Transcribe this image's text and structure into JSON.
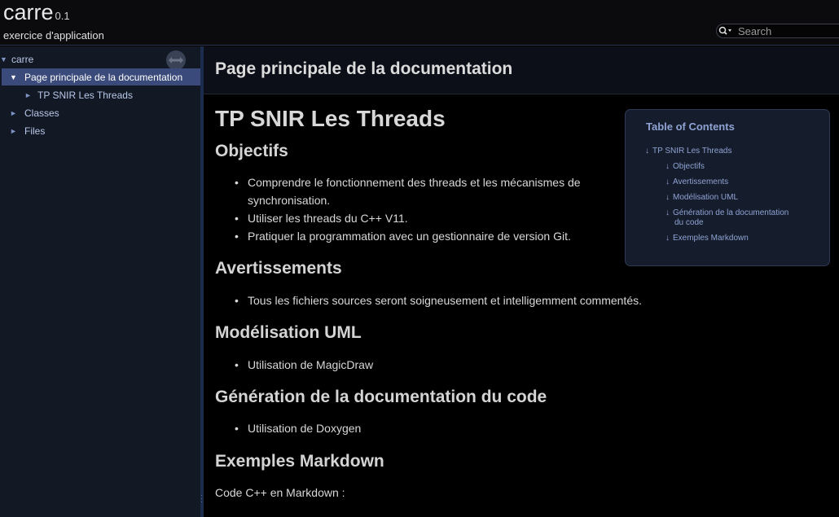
{
  "header": {
    "project_name": "carre",
    "project_number": "0.1",
    "project_brief": "exercice d'application",
    "search_placeholder": "Search"
  },
  "sidebar": {
    "items": [
      {
        "label": "carre",
        "arrow": "▼"
      },
      {
        "label": "Page principale de la documentation",
        "arrow": "▼",
        "selected": true
      },
      {
        "label": "TP SNIR Les Threads",
        "arrow": "►"
      },
      {
        "label": "Classes",
        "arrow": "►"
      },
      {
        "label": "Files",
        "arrow": "►"
      }
    ]
  },
  "main": {
    "page_title": "Page principale de la documentation",
    "h1": "TP SNIR Les Threads",
    "sections": [
      {
        "heading": "Objectifs",
        "items": [
          "Comprendre le fonctionnement des threads et les mécanismes de",
          "synchronisation.",
          "Utiliser les threads du C++ V11.",
          "Pratiquer la programmation avec un gestionnaire de version Git."
        ]
      },
      {
        "heading": "Avertissements",
        "items": [
          "Tous les fichiers sources seront soigneusement et intelligemment commentés."
        ]
      },
      {
        "heading": "Modélisation UML",
        "items": [
          "Utilisation de MagicDraw"
        ]
      },
      {
        "heading": "Génération de la documentation du code",
        "items": [
          "Utilisation de Doxygen"
        ]
      },
      {
        "heading": "Exemples Markdown",
        "paragraph": "Code C++ en Markdown :"
      }
    ]
  },
  "toc": {
    "title": "Table of Contents",
    "arrow": "↓",
    "entries": [
      "TP SNIR Les Threads",
      "Objectifs",
      "Avertissements",
      "Modélisation UML",
      "Génération de la documentation",
      "du code",
      "Exemples Markdown"
    ]
  },
  "colors": {
    "background": "#000000",
    "sidebar": "#121824",
    "selected": "#3a4a7a",
    "link": "#8fa3d3"
  }
}
